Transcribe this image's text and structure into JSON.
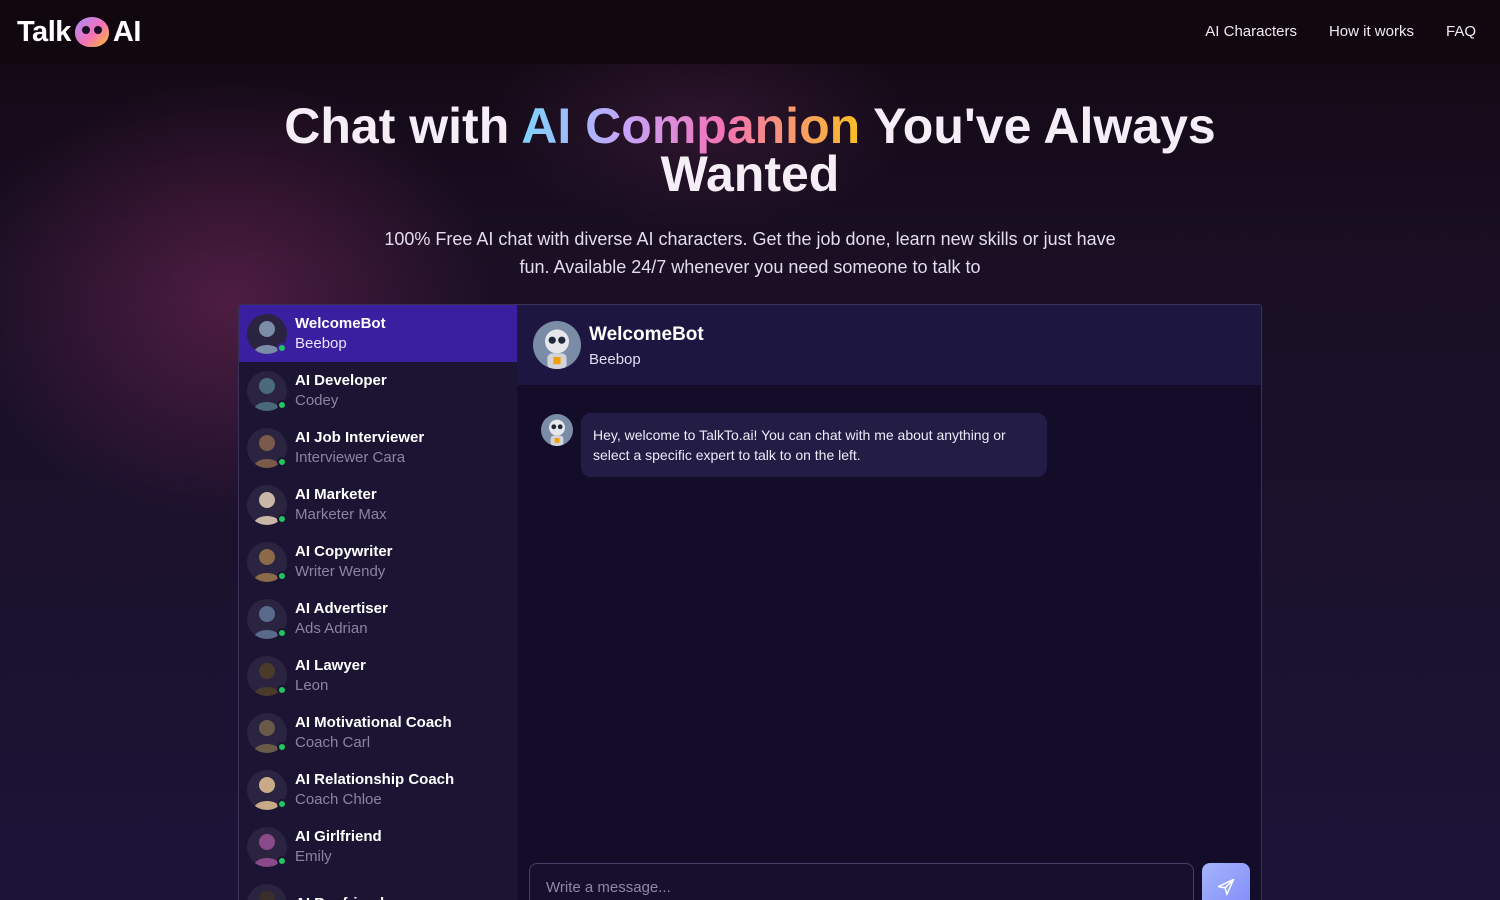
{
  "brand": {
    "name_left": "Talk",
    "name_right": "AI"
  },
  "nav": {
    "items": [
      "AI Characters",
      "How it works",
      "FAQ"
    ]
  },
  "hero": {
    "title_start": "Chat with ",
    "title_highlight": "AI Companion",
    "title_end": " You've Always Wanted",
    "subtitle": "100% Free AI chat with diverse AI characters. Get the job done, learn new skills or just have fun. Available 24/7 whenever you need someone to talk to"
  },
  "contacts": [
    {
      "name": "WelcomeBot",
      "sub": "Beebop",
      "active": true,
      "color": "#7b8ca6"
    },
    {
      "name": "AI Developer",
      "sub": "Codey",
      "color": "#4a6a7a"
    },
    {
      "name": "AI Job Interviewer",
      "sub": "Interviewer Cara",
      "color": "#7a5a4a"
    },
    {
      "name": "AI Marketer",
      "sub": "Marketer Max",
      "color": "#c8b6a6"
    },
    {
      "name": "AI Copywriter",
      "sub": "Writer Wendy",
      "color": "#8a6a48"
    },
    {
      "name": "AI Advertiser",
      "sub": "Ads Adrian",
      "color": "#5a6a8a"
    },
    {
      "name": "AI Lawyer",
      "sub": "Leon",
      "color": "#4a3a2a"
    },
    {
      "name": "AI Motivational Coach",
      "sub": "Coach Carl",
      "color": "#6a5a4a"
    },
    {
      "name": "AI Relationship Coach",
      "sub": "Coach Chloe",
      "color": "#c8aa88"
    },
    {
      "name": "AI Girlfriend",
      "sub": "Emily",
      "color": "#8a4a8a"
    },
    {
      "name": "AI Boyfriend",
      "sub": "",
      "color": "#3a2e2a"
    }
  ],
  "chat": {
    "title": "WelcomeBot",
    "subtitle": "Beebop",
    "messages": [
      {
        "text": "Hey, welcome to TalkTo.ai! You can chat with me about anything or select a specific expert to talk to on the left."
      }
    ],
    "input_placeholder": "Write a message...",
    "input_value": ""
  },
  "colors": {
    "accent": "#3a1fa0",
    "online": "#22c55e",
    "send": "#818cf8"
  }
}
